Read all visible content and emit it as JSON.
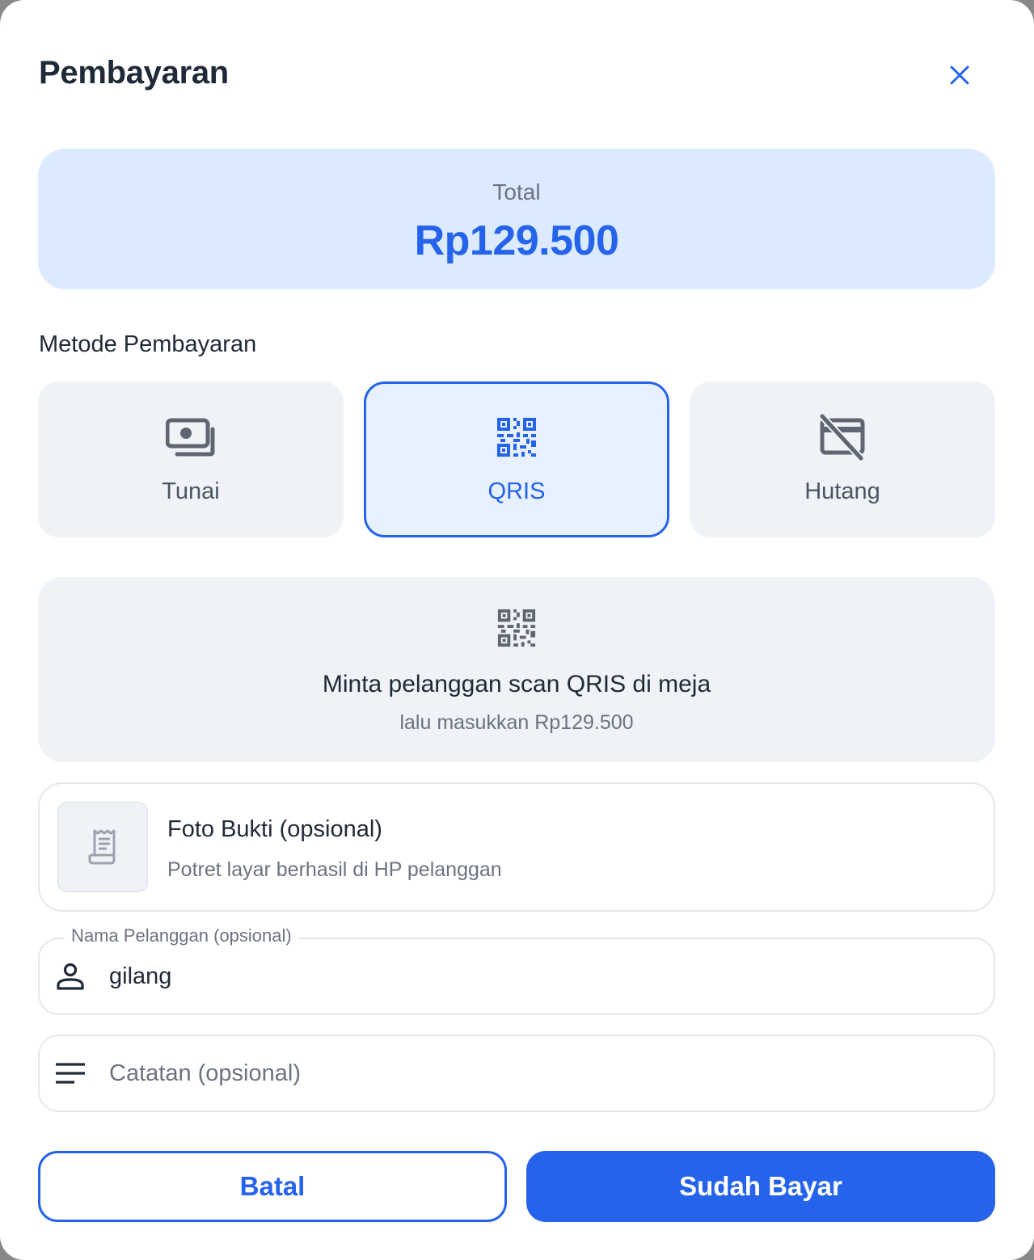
{
  "dialog": {
    "title": "Pembayaran"
  },
  "total": {
    "label": "Total",
    "value": "Rp129.500"
  },
  "payment_method": {
    "section_label": "Metode Pembayaran",
    "options": [
      {
        "label": "Tunai",
        "icon": "cash-icon",
        "selected": false
      },
      {
        "label": "QRIS",
        "icon": "qr-code-icon",
        "selected": true
      },
      {
        "label": "Hutang",
        "icon": "credit-off-icon",
        "selected": false
      }
    ]
  },
  "qris_info": {
    "icon": "qr-code-icon",
    "title": "Minta pelanggan scan QRIS di meja",
    "subtitle": "lalu masukkan Rp129.500"
  },
  "proof": {
    "icon": "receipt-icon",
    "title": "Foto Bukti (opsional)",
    "subtitle": "Potret layar berhasil di HP pelanggan"
  },
  "customer_name": {
    "label": "Nama Pelanggan (opsional)",
    "value": "gilang",
    "icon": "person-icon"
  },
  "notes": {
    "placeholder": "Catatan (opsional)",
    "value": "",
    "icon": "notes-icon"
  },
  "actions": {
    "cancel_label": "Batal",
    "confirm_label": "Sudah Bayar"
  },
  "colors": {
    "primary": "#2563eb",
    "primary_light": "#dbeafe",
    "card_bg": "#eff3f7",
    "text_dark": "#1f2937",
    "text_muted": "#6b7280",
    "icon_gray": "#5f6672"
  }
}
